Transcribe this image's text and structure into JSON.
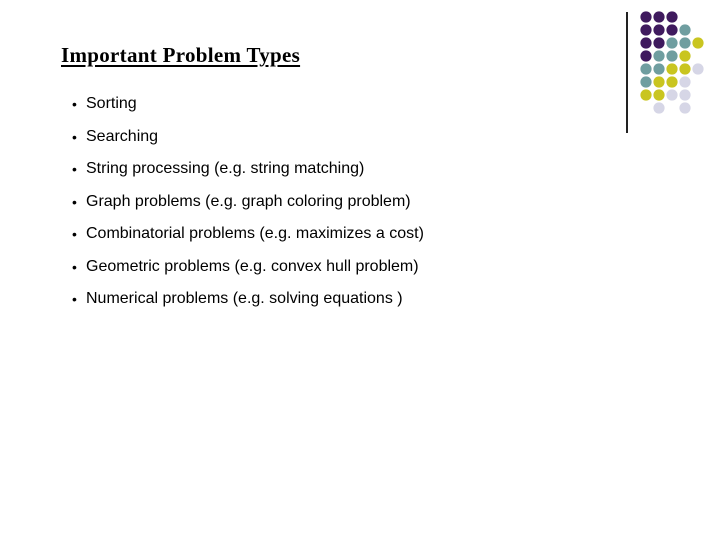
{
  "slide": {
    "title": "Important Problem Types",
    "bullet_glyph": "•",
    "bullets": [
      "Sorting",
      "Searching",
      "String processing (e.g. string matching)",
      "Graph problems (e.g. graph coloring problem)",
      "Combinatorial problems (e.g. maximizes a cost)",
      "Geometric problems (e.g. convex hull problem)",
      "Numerical problems (e.g. solving equations )"
    ]
  },
  "decoration": {
    "colors": {
      "P": "#3f1a5e",
      "T": "#6f9ea0",
      "Y": "#c9c520",
      "L": "#d6d6e6"
    },
    "dot_grid": [
      "PPP",
      "PPPT",
      "PPTTY",
      "PTTY",
      "TTYYL",
      "TYYL",
      "YYLL",
      " L L"
    ]
  }
}
